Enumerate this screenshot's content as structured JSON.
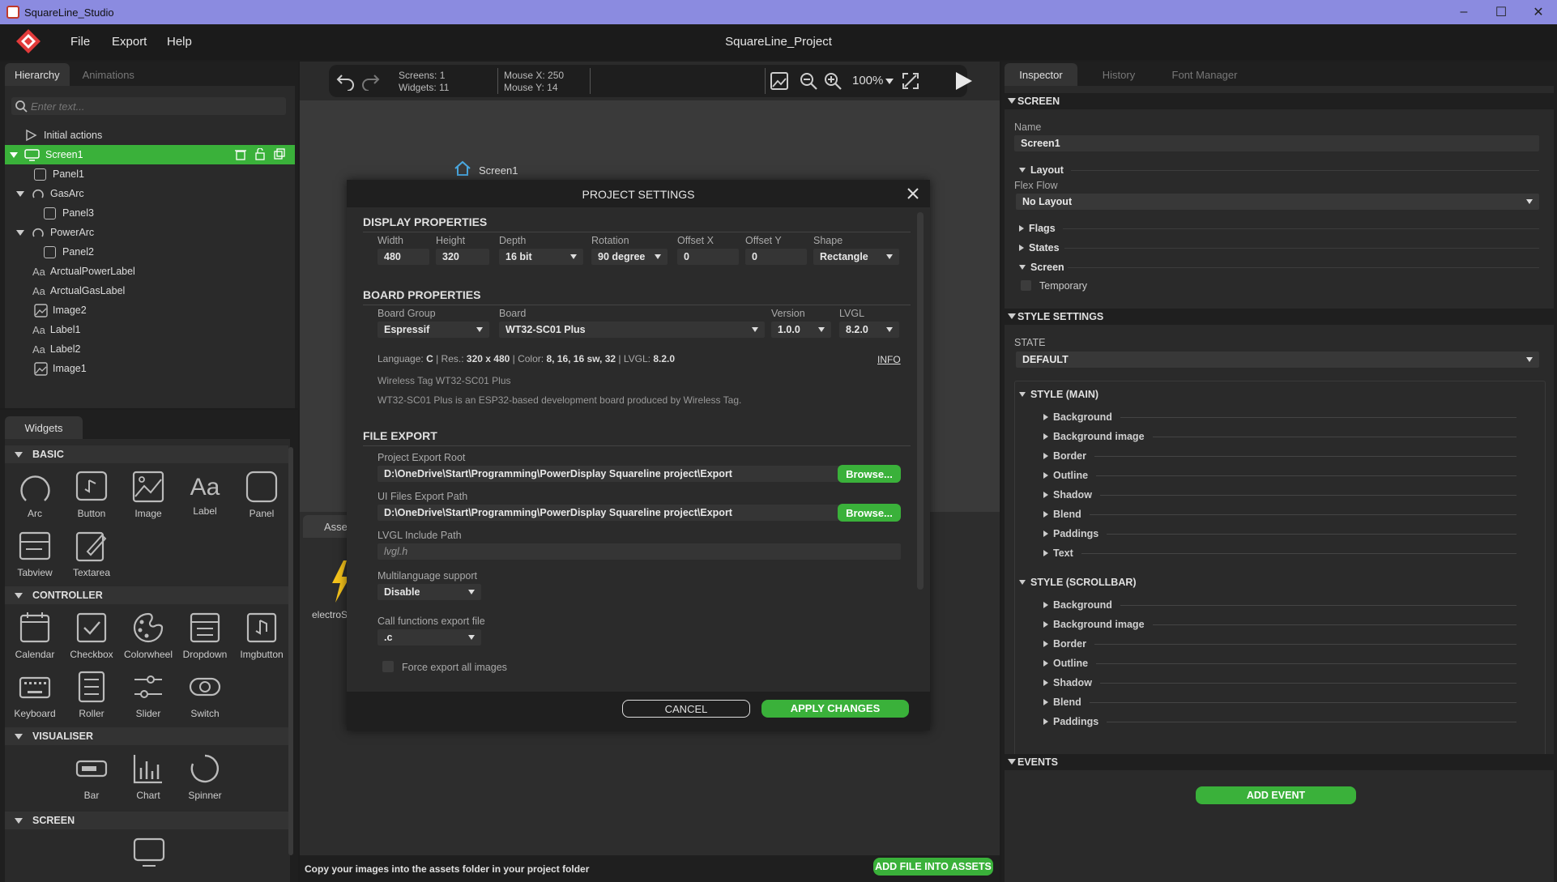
{
  "window": {
    "title": "SquareLine_Studio",
    "minimize": "–",
    "maximize": "☐",
    "close": "✕"
  },
  "menu": {
    "items": [
      "File",
      "Export",
      "Help"
    ],
    "project_name": "SquareLine_Project"
  },
  "left": {
    "tabs": [
      "Hierarchy",
      "Animations"
    ],
    "search_placeholder": "Enter text...",
    "hierarchy": [
      {
        "label": "Initial actions",
        "icon": "play-icon"
      },
      {
        "label": "Screen1",
        "icon": "screen-icon"
      },
      {
        "label": "Panel1",
        "icon": "panel-icon"
      },
      {
        "label": "GasArc",
        "icon": "arc-icon"
      },
      {
        "label": "Panel3",
        "icon": "panel-icon"
      },
      {
        "label": "PowerArc",
        "icon": "arc-icon"
      },
      {
        "label": "Panel2",
        "icon": "panel-icon"
      },
      {
        "label": "ArctualPowerLabel",
        "icon": "label-icon"
      },
      {
        "label": "ArctualGasLabel",
        "icon": "label-icon"
      },
      {
        "label": "Image2",
        "icon": "image-icon"
      },
      {
        "label": "Label1",
        "icon": "label-icon"
      },
      {
        "label": "Label2",
        "icon": "label-icon"
      },
      {
        "label": "Image1",
        "icon": "image-icon"
      }
    ],
    "label_glyph": "Aa",
    "widgets_tab": "Widgets",
    "groups": {
      "basic": {
        "title": "BASIC",
        "items": [
          "Arc",
          "Button",
          "Image",
          "Label",
          "Panel",
          "Tabview",
          "Textarea"
        ]
      },
      "controller": {
        "title": "CONTROLLER",
        "items": [
          "Calendar",
          "Checkbox",
          "Colorwheel",
          "Dropdown",
          "Imgbutton",
          "Keyboard",
          "Roller",
          "Slider",
          "Switch"
        ]
      },
      "visualiser": {
        "title": "VISUALISER",
        "items": [
          "Bar",
          "Chart",
          "Spinner"
        ]
      },
      "screen": {
        "title": "SCREEN"
      }
    }
  },
  "toolbar": {
    "screens": "Screens: 1",
    "widgets": "Widgets: 11",
    "mouse_x": "Mouse X: 250",
    "mouse_y": "Mouse Y: 14",
    "zoom": "100%"
  },
  "canvas": {
    "screen_label": "Screen1",
    "assets_tab": "Asse",
    "asset_name": "electroS",
    "footer_text": "Copy your images into the assets folder in your project folder",
    "add_file_button": "ADD FILE INTO ASSETS"
  },
  "dialog": {
    "title": "PROJECT SETTINGS",
    "display": {
      "heading": "DISPLAY PROPERTIES",
      "width_label": "Width",
      "width": "480",
      "height_label": "Height",
      "height": "320",
      "depth_label": "Depth",
      "depth": "16 bit",
      "rotation_label": "Rotation",
      "rotation": "90 degree",
      "offx_label": "Offset X",
      "offx": "0",
      "offy_label": "Offset Y",
      "offy": "0",
      "shape_label": "Shape",
      "shape": "Rectangle"
    },
    "board": {
      "heading": "BOARD PROPERTIES",
      "group_label": "Board Group",
      "group": "Espressif",
      "board_label": "Board",
      "board": "WT32-SC01 Plus",
      "version_label": "Version",
      "version": "1.0.0",
      "lvgl_label": "LVGL",
      "lvgl": "8.2.0",
      "info_language": "Language:",
      "info_language_v": "C",
      "info_res": "Res.:",
      "info_res_v": "320 x 480",
      "info_color": "Color:",
      "info_color_v": "8, 16, 16 sw, 32",
      "info_lvgl": "LVGL:",
      "info_lvgl_v": "8.2.0",
      "info_link": "INFO",
      "board_name": "Wireless Tag WT32-SC01 Plus",
      "board_desc": "WT32-SC01 Plus is an ESP32-based development board produced by Wireless Tag."
    },
    "export": {
      "heading": "FILE EXPORT",
      "root_label": "Project Export Root",
      "root": "D:\\OneDrive\\Start\\Programming\\PowerDisplay Squareline project\\Export",
      "ui_label": "UI Files Export Path",
      "ui": "D:\\OneDrive\\Start\\Programming\\PowerDisplay Squareline project\\Export",
      "browse": "Browse...",
      "lvgl_include_label": "LVGL Include Path",
      "lvgl_include": "lvgl.h",
      "multilang_label": "Multilanguage support",
      "multilang": "Disable",
      "callfn_label": "Call functions export file",
      "callfn": ".c",
      "force_label": "Force export all images"
    },
    "cancel": "CANCEL",
    "apply": "APPLY CHANGES"
  },
  "inspector": {
    "tabs": [
      "Inspector",
      "History",
      "Font Manager"
    ],
    "screen_heading": "SCREEN",
    "name_label": "Name",
    "name_value": "Screen1",
    "layout_heading": "Layout",
    "flexflow_label": "Flex Flow",
    "flexflow_value": "No Layout",
    "flags": "Flags",
    "states": "States",
    "screen_sub": "Screen",
    "temporary": "Temporary",
    "style_settings": "STYLE SETTINGS",
    "state_label": "STATE",
    "state_value": "DEFAULT",
    "style_main": "STYLE (MAIN)",
    "main_items": [
      "Background",
      "Background image",
      "Border",
      "Outline",
      "Shadow",
      "Blend",
      "Paddings",
      "Text"
    ],
    "style_scrollbar": "STYLE (SCROLLBAR)",
    "scroll_items": [
      "Background",
      "Background image",
      "Border",
      "Outline",
      "Shadow",
      "Blend",
      "Paddings"
    ],
    "events_heading": "EVENTS",
    "add_event": "ADD EVENT"
  },
  "colors": {
    "accent_green": "#3ab13a",
    "titlebar": "#8b8be0",
    "panel": "#262626"
  }
}
